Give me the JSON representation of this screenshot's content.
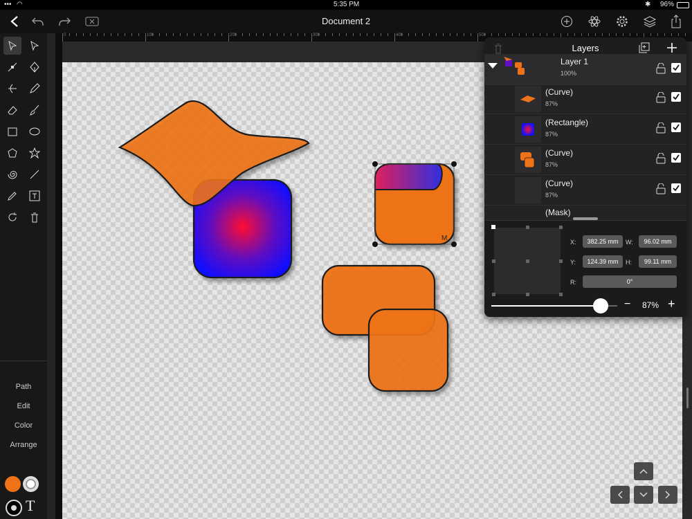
{
  "status_bar": {
    "time": "5:35 PM",
    "battery": "96%"
  },
  "toolbar": {
    "title": "Document 2"
  },
  "ruler": {
    "labels": [
      "0",
      "100",
      "200",
      "300",
      "400",
      "500"
    ]
  },
  "left_menu": {
    "path": "Path",
    "edit": "Edit",
    "color": "Color",
    "arrange": "Arrange"
  },
  "canvas": {
    "selection_handle_label": "M"
  },
  "layers_panel": {
    "title": "Layers",
    "rows": [
      {
        "name": "Layer 1",
        "opacity": "100%"
      },
      {
        "name": "(Curve)",
        "opacity": "87%"
      },
      {
        "name": "(Rectangle)",
        "opacity": "87%"
      },
      {
        "name": "(Curve)",
        "opacity": "87%"
      },
      {
        "name": "(Curve)",
        "opacity": "87%"
      },
      {
        "name": "(Mask)",
        "opacity": ""
      }
    ],
    "props": {
      "x_label": "X:",
      "x_value": "382.25 mm",
      "w_label": "W:",
      "w_value": "96.02 mm",
      "y_label": "Y:",
      "y_value": "124.39 mm",
      "h_label": "H:",
      "h_value": "99.11 mm",
      "r_label": "R:",
      "r_value": "0°",
      "opacity_value": "87%",
      "opacity_fraction": 0.87,
      "minus": "−",
      "plus": "+"
    }
  },
  "colors": {
    "fill": "#ee7318",
    "stroke_swatch": "#e0e0e0",
    "accent": "#3a3a3c"
  }
}
